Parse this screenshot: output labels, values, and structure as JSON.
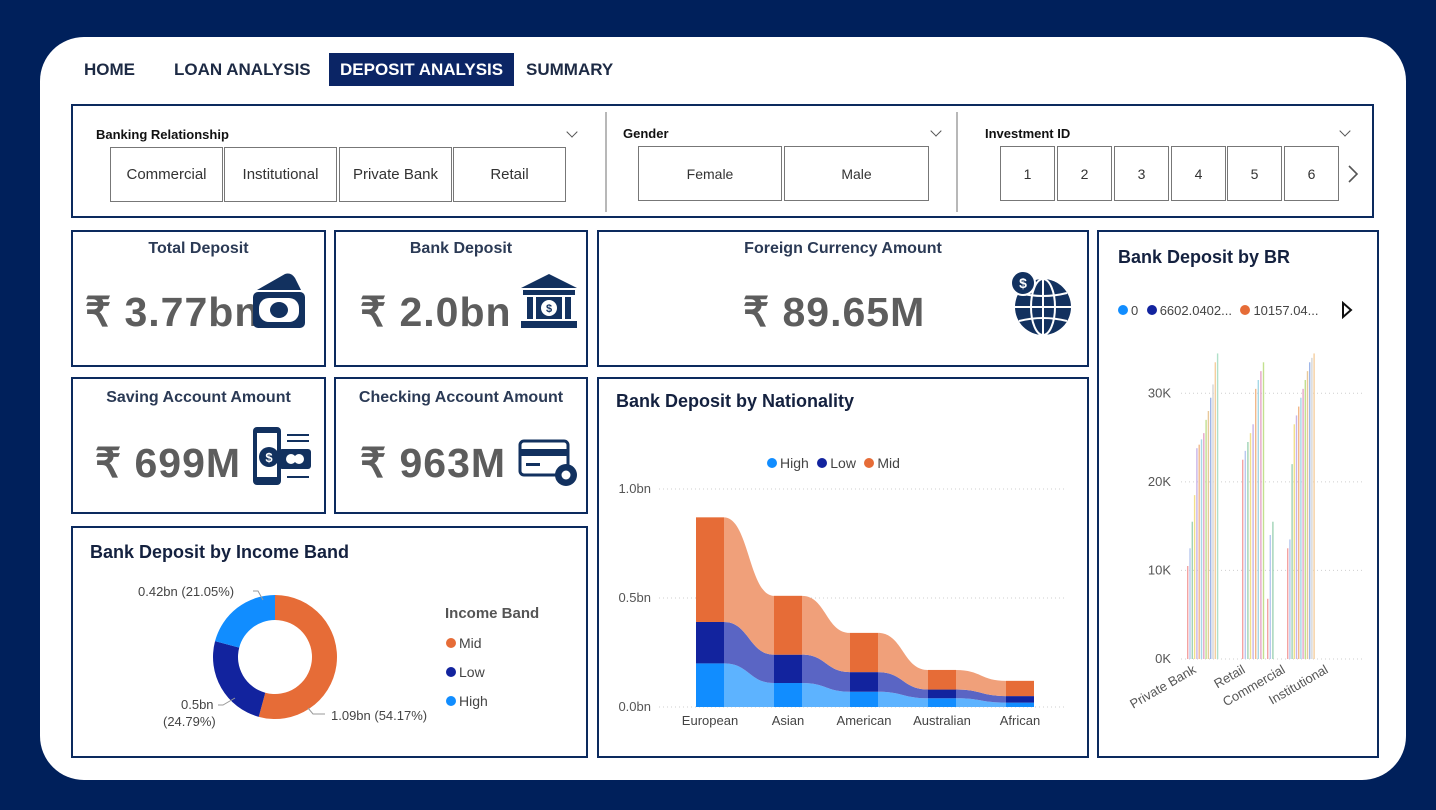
{
  "nav": {
    "tabs": [
      {
        "label": "HOME",
        "active": false
      },
      {
        "label": "LOAN ANALYSIS",
        "active": false
      },
      {
        "label": "DEPOSIT ANALYSIS",
        "active": true
      },
      {
        "label": "SUMMARY",
        "active": false
      }
    ]
  },
  "filters": {
    "banking_relationship": {
      "title": "Banking Relationship",
      "options": [
        "Commercial",
        "Institutional",
        "Private Bank",
        "Retail"
      ]
    },
    "gender": {
      "title": "Gender",
      "options": [
        "Female",
        "Male"
      ]
    },
    "investment_id": {
      "title": "Investment ID",
      "options": [
        "1",
        "2",
        "3",
        "4",
        "5",
        "6"
      ]
    }
  },
  "kpis": {
    "total_deposit": {
      "title": "Total Deposit",
      "value": "₹ 3.77bn",
      "icon": "cash-icon"
    },
    "bank_deposit": {
      "title": "Bank Deposit",
      "value": "₹ 2.0bn",
      "icon": "bank-icon"
    },
    "foreign_currency": {
      "title": "Foreign Currency Amount",
      "value": "₹ 89.65M",
      "icon": "globe-dollar-icon"
    },
    "saving_account": {
      "title": "Saving Account Amount",
      "value": "₹ 699M",
      "icon": "mobile-payment-icon"
    },
    "checking_account": {
      "title": "Checking Account Amount",
      "value": "₹ 963M",
      "icon": "card-settings-icon"
    }
  },
  "colors": {
    "navy": "#00205B",
    "high": "#118DFF",
    "low": "#12239E",
    "mid": "#E66C37"
  },
  "chart_data": [
    {
      "type": "pie",
      "title": "Bank Deposit by Income Band",
      "legend_title": "Income Band",
      "categories": [
        "Mid",
        "Low",
        "High"
      ],
      "values": [
        1.09,
        0.5,
        0.42
      ],
      "labels": [
        "1.09bn (54.17%)",
        "0.5bn (24.79%)",
        "0.42bn (21.05%)"
      ],
      "label_parts": {
        "low_value": "0.5bn",
        "low_pct": "(24.79%)"
      },
      "unit": "bn"
    },
    {
      "type": "area",
      "subtype": "ribbon",
      "title": "Bank Deposit by Nationality",
      "categories": [
        "European",
        "Asian",
        "American",
        "Australian",
        "African"
      ],
      "series": [
        {
          "name": "High",
          "values": [
            0.2,
            0.11,
            0.07,
            0.04,
            0.02
          ]
        },
        {
          "name": "Low",
          "values": [
            0.19,
            0.13,
            0.09,
            0.04,
            0.03
          ]
        },
        {
          "name": "Mid",
          "values": [
            0.48,
            0.27,
            0.18,
            0.09,
            0.07
          ]
        }
      ],
      "yticks": [
        "0.0bn",
        "0.5bn",
        "1.0bn"
      ],
      "ylim": [
        0,
        1.0
      ],
      "grid": true,
      "legend": "top-center"
    },
    {
      "type": "bar",
      "title": "Bank Deposit by BR",
      "categories": [
        "Private Bank",
        "Retail",
        "Commercial",
        "Institutional"
      ],
      "legend_entries": [
        "0",
        "6602.0402...",
        "10157.04..."
      ],
      "yticks": [
        "0K",
        "10K",
        "20K",
        "30K"
      ],
      "ylim": [
        0,
        35000
      ],
      "series_per_category_values": [
        [
          10500,
          12500,
          15500,
          18500,
          23800,
          24200,
          24800,
          25500,
          27000,
          28000,
          29500,
          31000,
          33500,
          34500
        ],
        [
          22500,
          23500,
          24500,
          25500,
          26500,
          30500,
          31500,
          32500,
          33500
        ],
        [
          6800,
          14000,
          15500
        ],
        [
          12500,
          13500,
          22000,
          26500,
          27500,
          28500,
          29500,
          30500,
          31500,
          32500,
          33500,
          34000,
          34500
        ]
      ],
      "grid": true,
      "legend": "top-left"
    }
  ]
}
